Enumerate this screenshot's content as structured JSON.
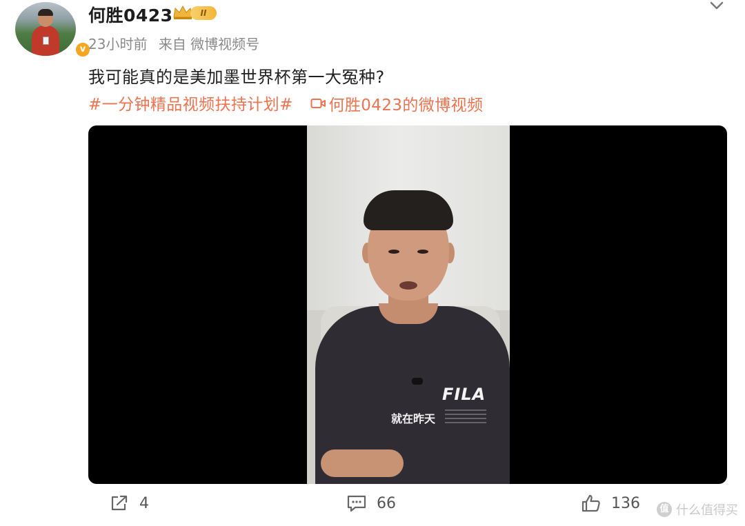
{
  "post": {
    "author": {
      "name": "何胜0423",
      "level": "II",
      "verified_icon": "verified-badge-icon",
      "avatar_icon": "avatar"
    },
    "meta": {
      "time": "23小时前",
      "source": "来自 微博视频号"
    },
    "text": "我可能真的是美加墨世界杯第一大冤种?",
    "topic": "#一分钟精品视频扶持计划#",
    "video_link": "何胜0423的微博视频",
    "video": {
      "shirt_logo": "FILA",
      "shirt_print": "就在昨天"
    }
  },
  "actions": {
    "share_count": "4",
    "comment_count": "66",
    "like_count": "136"
  },
  "watermark": {
    "text": "什么值得买",
    "icon_char": "值"
  },
  "colors": {
    "accent": "#eb7350",
    "level_badge": "#f2b53c",
    "verified": "#f5a623",
    "video_bg": "#000000"
  }
}
